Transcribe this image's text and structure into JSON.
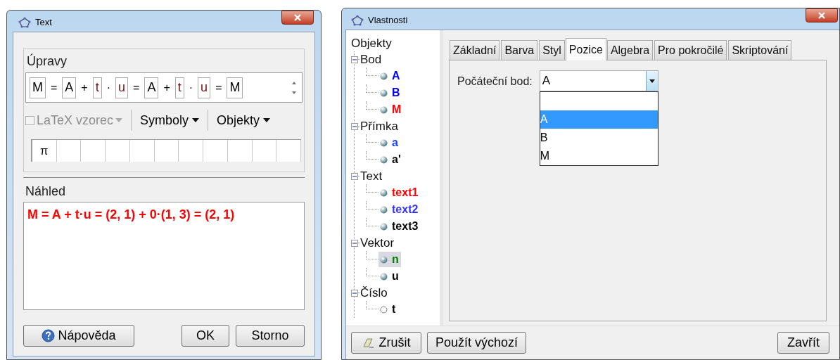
{
  "text_window": {
    "title": "Text",
    "edit_group": {
      "label": "Úpravy",
      "tokens": [
        {
          "kind": "field",
          "text": "M",
          "color": "#000000"
        },
        {
          "kind": "operator",
          "text": "="
        },
        {
          "kind": "field",
          "text": "A",
          "color": "#000000"
        },
        {
          "kind": "operator",
          "text": "+"
        },
        {
          "kind": "field",
          "text": "t",
          "color": "#7a1010"
        },
        {
          "kind": "operator",
          "text": "·"
        },
        {
          "kind": "field",
          "text": "u",
          "color": "#7a1010"
        },
        {
          "kind": "operator",
          "text": "="
        },
        {
          "kind": "field",
          "text": "A",
          "color": "#000000"
        },
        {
          "kind": "operator",
          "text": "+"
        },
        {
          "kind": "field",
          "text": "t",
          "color": "#7a1010"
        },
        {
          "kind": "operator",
          "text": "·"
        },
        {
          "kind": "field",
          "text": "u",
          "color": "#7a1010"
        },
        {
          "kind": "operator",
          "text": "="
        },
        {
          "kind": "field",
          "text": "M",
          "color": "#000000"
        }
      ],
      "latex": {
        "label": "LaTeX vzorec",
        "checked": false,
        "disabled": true
      },
      "menus": [
        "Symboly",
        "Objekty"
      ],
      "symbols": [
        "π"
      ]
    },
    "preview": {
      "label": "Náhled",
      "text": "M = A + t·u = (2, 1) + 0·(1, 3) = (2, 1)"
    },
    "buttons": [
      {
        "kind": "help",
        "label": "Nápověda"
      },
      {
        "kind": "plain",
        "label": "OK"
      },
      {
        "kind": "plain",
        "label": "Storno"
      }
    ]
  },
  "properties_window": {
    "title": "Vlastnosti",
    "tree": {
      "root": "Objekty",
      "children": [
        {
          "label": "Bod",
          "expanded": true,
          "children": [
            {
              "label": "A",
              "color": "#0000ff",
              "visible": true,
              "selected": false
            },
            {
              "label": "B",
              "color": "#0000ff",
              "visible": true,
              "selected": false
            },
            {
              "label": "M",
              "color": "#ff0000",
              "visible": true,
              "selected": false
            }
          ]
        },
        {
          "label": "Přímka",
          "expanded": true,
          "children": [
            {
              "label": "a",
              "color": "#1a3cff",
              "visible": true,
              "selected": false
            },
            {
              "label": "a'",
              "color": "#000000",
              "visible": true,
              "selected": false
            }
          ]
        },
        {
          "label": "Text",
          "expanded": true,
          "children": [
            {
              "label": "text1",
              "color": "#ff0000",
              "visible": true,
              "selected": false
            },
            {
              "label": "text2",
              "color": "#3333ff",
              "visible": true,
              "selected": false
            },
            {
              "label": "text3",
              "color": "#000000",
              "visible": true,
              "selected": false
            }
          ]
        },
        {
          "label": "Vektor",
          "expanded": true,
          "children": [
            {
              "label": "n",
              "color": "#008000",
              "visible": true,
              "selected": true
            },
            {
              "label": "u",
              "color": "#000000",
              "visible": true,
              "selected": false
            }
          ]
        },
        {
          "label": "Číslo",
          "expanded": true,
          "children": [
            {
              "label": "t",
              "color": "#000000",
              "visible": false,
              "selected": false
            }
          ]
        }
      ]
    },
    "tabs": [
      {
        "label": "Základní",
        "selected": false
      },
      {
        "label": "Barva",
        "selected": false
      },
      {
        "label": "Styl",
        "selected": false
      },
      {
        "label": "Pozice",
        "selected": true
      },
      {
        "label": "Algebra",
        "selected": false
      },
      {
        "label": "Pro pokročilé",
        "selected": false
      },
      {
        "label": "Skriptování",
        "selected": false
      }
    ],
    "start_point": {
      "label": "Počáteční bod:",
      "value": "A",
      "expanded": true,
      "options": [
        {
          "label": "A",
          "selected": true
        },
        {
          "label": "B",
          "selected": false
        },
        {
          "label": "M",
          "selected": false
        }
      ]
    },
    "buttons": [
      {
        "kind": "eraser",
        "label": "Zrušit"
      },
      {
        "kind": "plain",
        "label": "Použít výchozí"
      },
      {
        "kind": "plain",
        "label": "Zavřít"
      }
    ]
  }
}
